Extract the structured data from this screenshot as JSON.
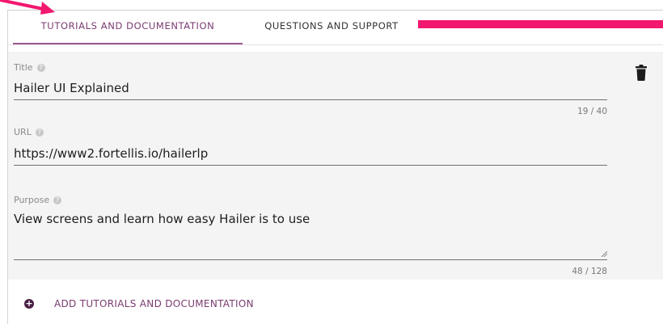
{
  "tabs": [
    {
      "label": "TUTORIALS AND DOCUMENTATION",
      "active": true
    },
    {
      "label": "QUESTIONS AND SUPPORT",
      "active": false
    }
  ],
  "form": {
    "title": {
      "label": "Title",
      "value": "Hailer UI Explained",
      "counter": "19 / 40"
    },
    "url": {
      "label": "URL",
      "value": "https://www2.fortellis.io/hailerlp"
    },
    "purpose": {
      "label": "Purpose",
      "value": "View screens and learn how easy Hailer is to use",
      "counter": "48 / 128"
    }
  },
  "actions": {
    "add_label": "ADD TUTORIALS AND DOCUMENTATION"
  },
  "icons": {
    "help": "help-circle-icon",
    "delete": "trash-icon",
    "add": "plus-circle-icon"
  },
  "colors": {
    "accent": "#7a3b70",
    "annotation": "#f2186f",
    "panel_bg": "#f4f4f4"
  }
}
